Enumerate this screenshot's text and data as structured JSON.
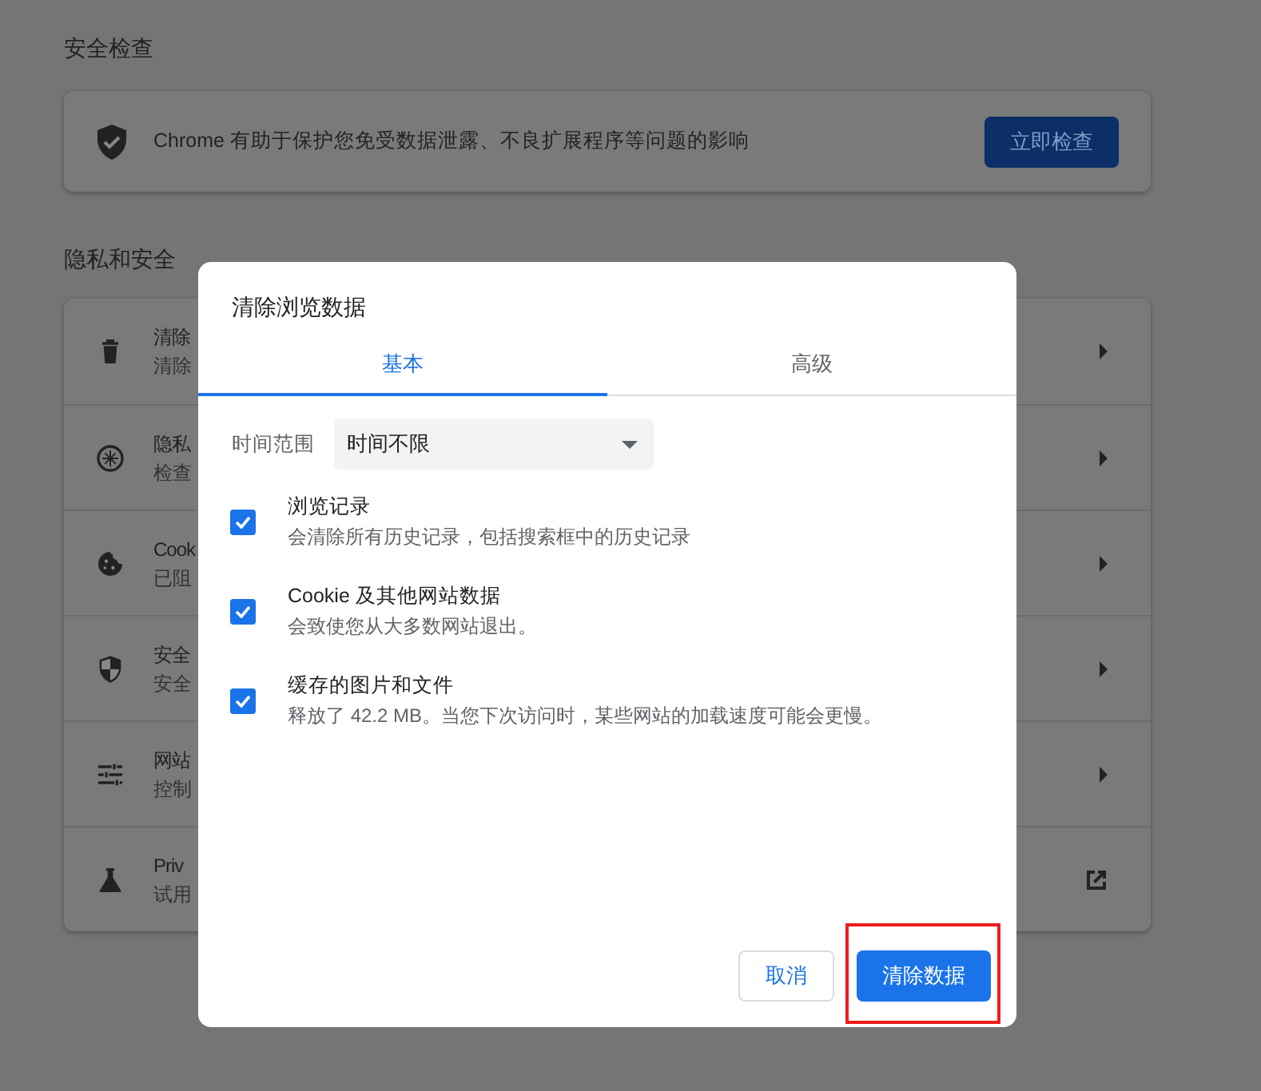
{
  "safety_check": {
    "heading": "安全检查",
    "text": "Chrome 有助于保护您免受数据泄露、不良扩展程序等问题的影响",
    "button": "立即检查"
  },
  "privacy": {
    "heading": "隐私和安全",
    "items": [
      {
        "kind": "page",
        "title": "清除",
        "subtitle": "清除"
      },
      {
        "kind": "page",
        "title": "隐私",
        "subtitle": "检查"
      },
      {
        "kind": "page",
        "title": "Cook",
        "subtitle": "已阻"
      },
      {
        "kind": "page",
        "title": "安全",
        "subtitle": "安全"
      },
      {
        "kind": "page",
        "title": "网站",
        "subtitle": "控制"
      },
      {
        "kind": "external",
        "title": "Priv",
        "subtitle": "试用"
      }
    ]
  },
  "dialog": {
    "title": "清除浏览数据",
    "tabs": [
      {
        "label": "基本",
        "selected": true
      },
      {
        "label": "高级",
        "selected": false
      }
    ],
    "time_range": {
      "label": "时间范围",
      "value": "时间不限"
    },
    "options": [
      {
        "title": "浏览记录",
        "description": "会清除所有历史记录，包括搜索框中的历史记录",
        "checked": true
      },
      {
        "title": "Cookie 及其他网站数据",
        "description": "会致使您从大多数网站退出。",
        "checked": true
      },
      {
        "title": "缓存的图片和文件",
        "description": "释放了 42.2 MB。当您下次访问时，某些网站的加载速度可能会更慢。",
        "checked": true
      }
    ],
    "buttons": [
      {
        "label": "取消",
        "kind": "secondary",
        "highlighted": false
      },
      {
        "label": "清除数据",
        "kind": "primary",
        "highlighted": true
      }
    ]
  }
}
